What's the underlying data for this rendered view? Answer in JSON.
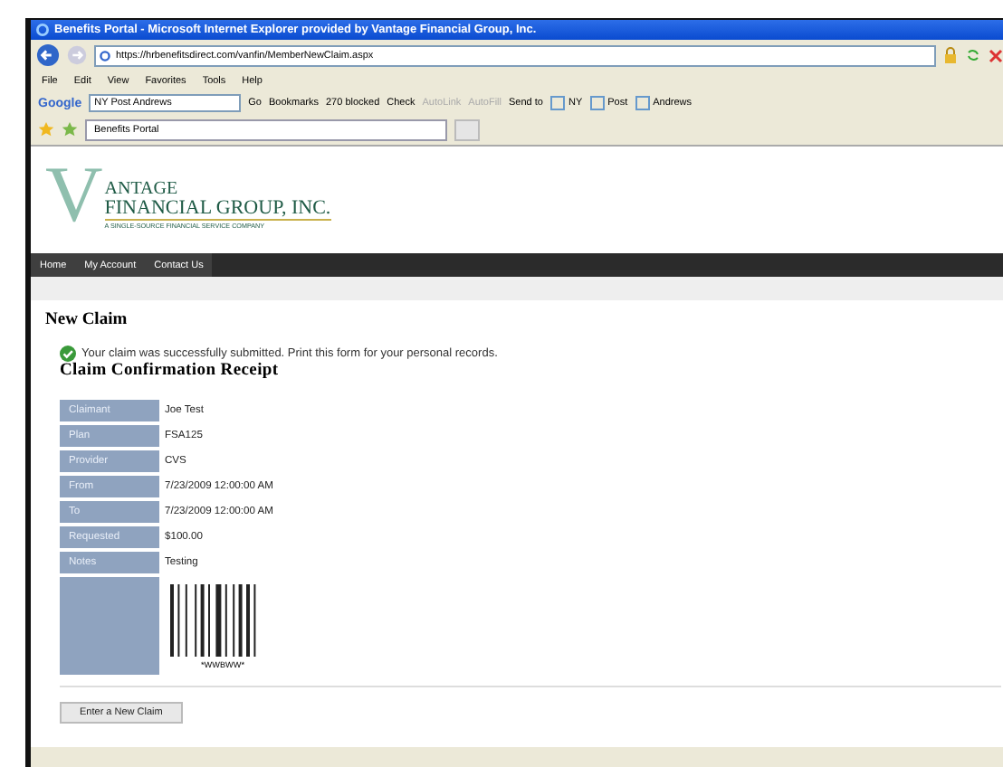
{
  "window": {
    "title": "Benefits Portal - Microsoft Internet Explorer provided by Vantage Financial Group, Inc."
  },
  "address_bar": {
    "url": "https://hrbenefitsdirect.com/vanfin/MemberNewClaim.aspx"
  },
  "menu": [
    "File",
    "Edit",
    "View",
    "Favorites",
    "Tools",
    "Help"
  ],
  "google_toolbar": {
    "logo": "Google",
    "search_value": "NY Post Andrews",
    "items": [
      {
        "kind": "button",
        "label": "Go",
        "disabled": false
      },
      {
        "kind": "menu",
        "label": "Bookmarks",
        "disabled": false
      },
      {
        "kind": "button",
        "label": "270 blocked",
        "disabled": false
      },
      {
        "kind": "menu",
        "label": "Check",
        "disabled": false
      },
      {
        "kind": "menu",
        "label": "AutoLink",
        "disabled": true
      },
      {
        "kind": "button",
        "label": "AutoFill",
        "disabled": true
      },
      {
        "kind": "menu",
        "label": "Send to",
        "disabled": false
      },
      {
        "kind": "search",
        "label": "NY",
        "disabled": false
      },
      {
        "kind": "search",
        "label": "Post",
        "disabled": false
      },
      {
        "kind": "search",
        "label": "Andrews",
        "disabled": false
      }
    ]
  },
  "tabs": [
    {
      "label": "Benefits Portal",
      "selected": true
    }
  ],
  "site": {
    "logo_initial": "V",
    "logo_line1": "ANTAGE",
    "logo_line2": "FINANCIAL GROUP, INC.",
    "tagline": "A SINGLE-SOURCE FINANCIAL SERVICE COMPANY",
    "nav": [
      "Home",
      "My Account",
      "Contact Us"
    ]
  },
  "page": {
    "heading": "New Claim",
    "message": "Your claim was successfully submitted. Print this form for your personal records.",
    "receipt_title": "Claim Confirmation Receipt",
    "rows": [
      {
        "label": "Claimant",
        "value": "Joe Test"
      },
      {
        "label": "Plan",
        "value": "FSA125"
      },
      {
        "label": "Provider",
        "value": "CVS"
      },
      {
        "label": "From",
        "value": "7/23/2009 12:00:00 AM"
      },
      {
        "label": "To",
        "value": "7/23/2009 12:00:00 AM"
      },
      {
        "label": "Requested",
        "value": "$100.00"
      },
      {
        "label": "Notes",
        "value": "Testing"
      }
    ],
    "barcode_text": "*WWBWW*",
    "button": "Enter a New Claim"
  }
}
